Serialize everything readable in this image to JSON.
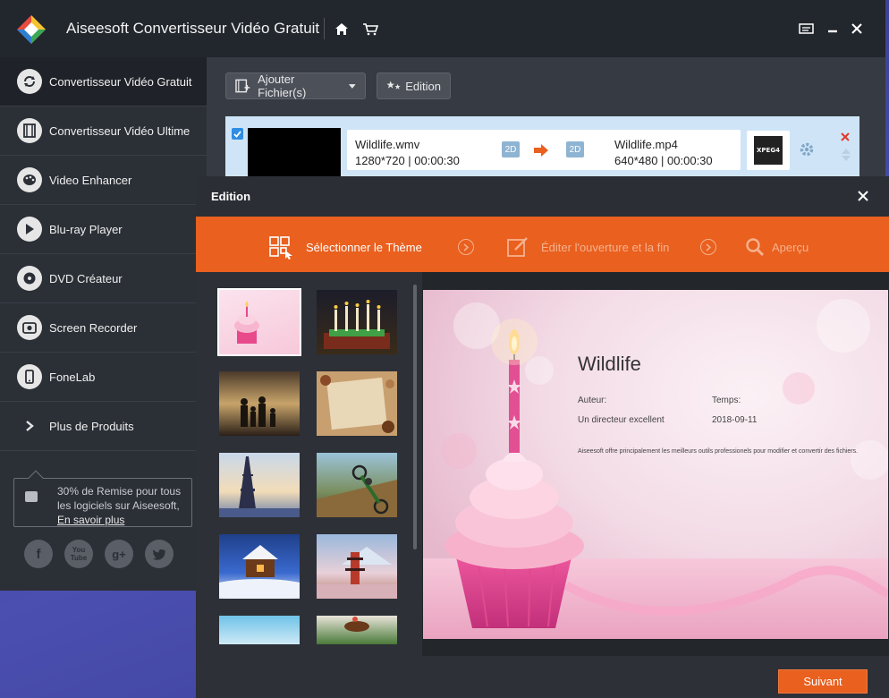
{
  "app": {
    "title": "Aiseesoft Convertisseur Vidéo Gratuit"
  },
  "sidebar": {
    "items": [
      {
        "label": "Convertisseur Vidéo Gratuit",
        "icon": "refresh-icon"
      },
      {
        "label": "Convertisseur Vidéo Ultime",
        "icon": "film-icon"
      },
      {
        "label": "Video Enhancer",
        "icon": "palette-icon"
      },
      {
        "label": "Blu-ray Player",
        "icon": "play-icon"
      },
      {
        "label": "DVD Créateur",
        "icon": "disc-icon"
      },
      {
        "label": "Screen Recorder",
        "icon": "camera-icon"
      },
      {
        "label": "FoneLab",
        "icon": "phone-icon"
      },
      {
        "label": "Plus de Produits",
        "icon": "chevron-right-icon"
      }
    ],
    "promo_text": "30% de Remise pour tous les logiciels sur Aiseesoft,",
    "promo_link": "En savoir plus"
  },
  "toolbar": {
    "add_files_label": "Ajouter Fichier(s)",
    "edit_label": "Edition"
  },
  "file": {
    "source_name": "Wildlife.wmv",
    "source_meta": "1280*720 | 00:00:30",
    "source_badge": "2D",
    "target_badge": "2D",
    "target_name": "Wildlife.mp4",
    "target_meta": "640*480 | 00:00:30",
    "format": "XPEG4"
  },
  "dialog": {
    "title": "Edition",
    "steps": [
      {
        "label": "Sélectionner le Thème",
        "active": true
      },
      {
        "label": "Éditer l'ouverture et la fin",
        "active": false
      },
      {
        "label": "Aperçu",
        "active": false
      }
    ],
    "next_label": "Suivant"
  },
  "preview": {
    "title": "Wildlife",
    "author_label": "Auteur:",
    "time_label": "Temps:",
    "author_value": "Un directeur excellent",
    "time_value": "2018-09-11",
    "description": "Aiseesoft offre principalement les meilleurs outils professionels pour modifier et convertir des fichiers."
  },
  "colors": {
    "accent": "#e9601f",
    "sidebar_bg": "#2b2f36",
    "titlebar_bg": "#22262d",
    "file_row_bg": "#cfe5f7"
  },
  "themes": [
    {
      "name": "cupcake-theme",
      "selected": true
    },
    {
      "name": "birthday-candles-theme",
      "selected": false
    },
    {
      "name": "family-sunset-theme",
      "selected": false
    },
    {
      "name": "christmas-frame-theme",
      "selected": false
    },
    {
      "name": "eiffel-tower-theme",
      "selected": false
    },
    {
      "name": "motocross-theme",
      "selected": false
    },
    {
      "name": "snow-cabin-theme",
      "selected": false
    },
    {
      "name": "pagoda-theme",
      "selected": false
    },
    {
      "name": "sky-theme",
      "selected": false
    },
    {
      "name": "horse-race-theme",
      "selected": false
    }
  ]
}
